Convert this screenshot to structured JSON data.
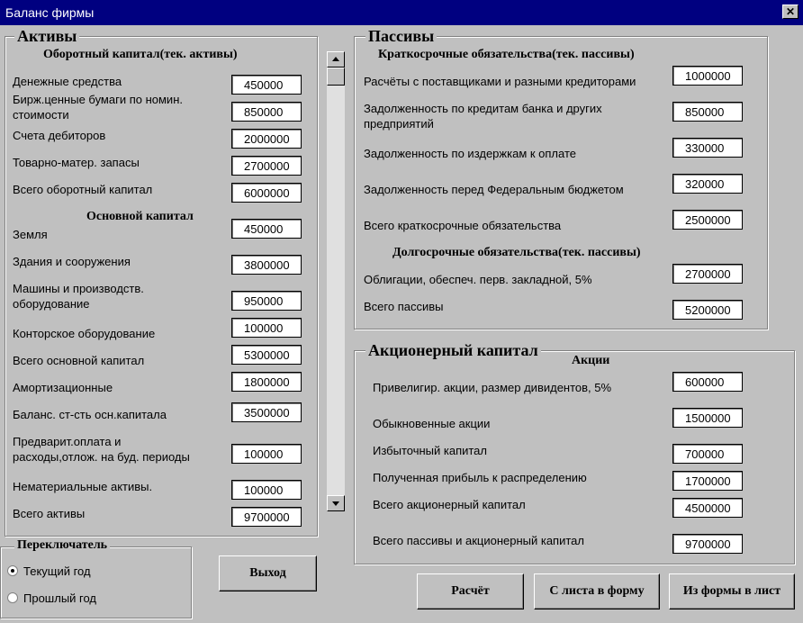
{
  "window": {
    "title": "Баланс фирмы",
    "close_label": "✕"
  },
  "assets": {
    "legend": "Активы",
    "working_head": "Оборотный капитал(тек. активы)",
    "fixed_head": "Основной капитал",
    "rows": [
      {
        "label": "Денежные средства",
        "value": "450000"
      },
      {
        "label": "Бирж.ценные бумаги по номин.",
        "label2": "стоимости",
        "value": "850000"
      },
      {
        "label": "Счета дебиторов",
        "value": "2000000"
      },
      {
        "label": "Товарно-матер. запасы",
        "value": "2700000"
      },
      {
        "label": "Всего оборотный капитал",
        "value": "6000000"
      },
      {
        "label": "Земля",
        "value": "450000"
      },
      {
        "label": "Здания и сооружения",
        "value": "3800000"
      },
      {
        "label": "Машины и производств.",
        "label2": "оборудование",
        "value": "950000"
      },
      {
        "label": "Конторское оборудование",
        "value": "100000"
      },
      {
        "label": "Всего основной капитал",
        "value": "5300000"
      },
      {
        "label": "Амортизационные",
        "value": "1800000"
      },
      {
        "label": "Баланс. ст-сть осн.капитала",
        "value": "3500000"
      },
      {
        "label": "Предварит.оплата и",
        "label2": "расходы,отлож. на буд. периоды",
        "value": "100000"
      },
      {
        "label": "Нематериальные активы.",
        "value": "100000"
      },
      {
        "label": "Всего активы",
        "value": "9700000"
      }
    ]
  },
  "liabilities": {
    "legend": "Пассивы",
    "short_head": "Краткосрочные обязательства(тек. пассивы)",
    "long_head": "Долгосрочные обязательства(тек. пассивы)",
    "rows": [
      {
        "label": "Расчёты с поставщиками и разными кредиторами",
        "value": "1000000"
      },
      {
        "label": "Задолженность по кредитам банка и других",
        "label2": "предприятий",
        "value": "850000"
      },
      {
        "label": "Задолженность по издержкам к оплате",
        "value": "330000"
      },
      {
        "label": "Задолженность перед Федеральным бюджетом",
        "value": "320000"
      },
      {
        "label": "Всего краткосрочные обязательства",
        "value": "2500000"
      },
      {
        "label": "Облигации, обеспеч. перв. закладной, 5%",
        "value": "2700000"
      },
      {
        "label": "Всего пассивы",
        "value": "5200000"
      }
    ]
  },
  "equity": {
    "legend": "Акционерный капитал",
    "head": "Акции",
    "rows": [
      {
        "label": "Привелигир. акции, размер дивидентов, 5%",
        "value": "600000"
      },
      {
        "label": "Обыкновенные акции",
        "value": "1500000"
      },
      {
        "label": "Избыточный капитал",
        "value": "700000"
      },
      {
        "label": "Полученная прибыль к распределению",
        "value": "1700000"
      },
      {
        "label": "Всего акционерный капитал",
        "value": "4500000"
      },
      {
        "label": "Всего пассивы и акционерный капитал",
        "value": "9700000"
      }
    ]
  },
  "switcher": {
    "legend": "Переключатель",
    "options": [
      {
        "label": "Текущий год",
        "selected": true
      },
      {
        "label": "Прошлый год",
        "selected": false
      }
    ]
  },
  "buttons": {
    "exit": "Выход",
    "calc": "Расчёт",
    "sheet_to_form": "С листа в форму",
    "form_to_sheet": "Из формы в лист"
  }
}
